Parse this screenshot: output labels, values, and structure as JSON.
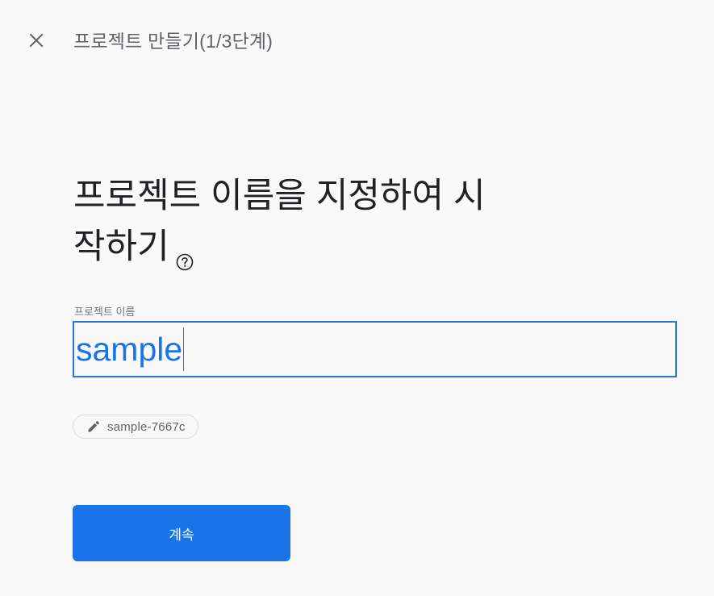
{
  "header": {
    "close_icon": "close-icon",
    "title": "프로젝트 만들기(1/3단계)"
  },
  "main": {
    "heading_line1": "프로젝트 이름을 지정하여 시",
    "heading_line2": "작하기",
    "help_icon": "help-circle-icon"
  },
  "project_name_field": {
    "label": "프로젝트 이름",
    "value": "sample"
  },
  "project_id_chip": {
    "icon": "pencil-icon",
    "value": "sample-7667c"
  },
  "actions": {
    "continue_label": "계속"
  },
  "colors": {
    "accent": "#1a73e8",
    "background": "#f9f9fa",
    "heading_text": "#202124",
    "secondary_text": "#5f6368"
  }
}
